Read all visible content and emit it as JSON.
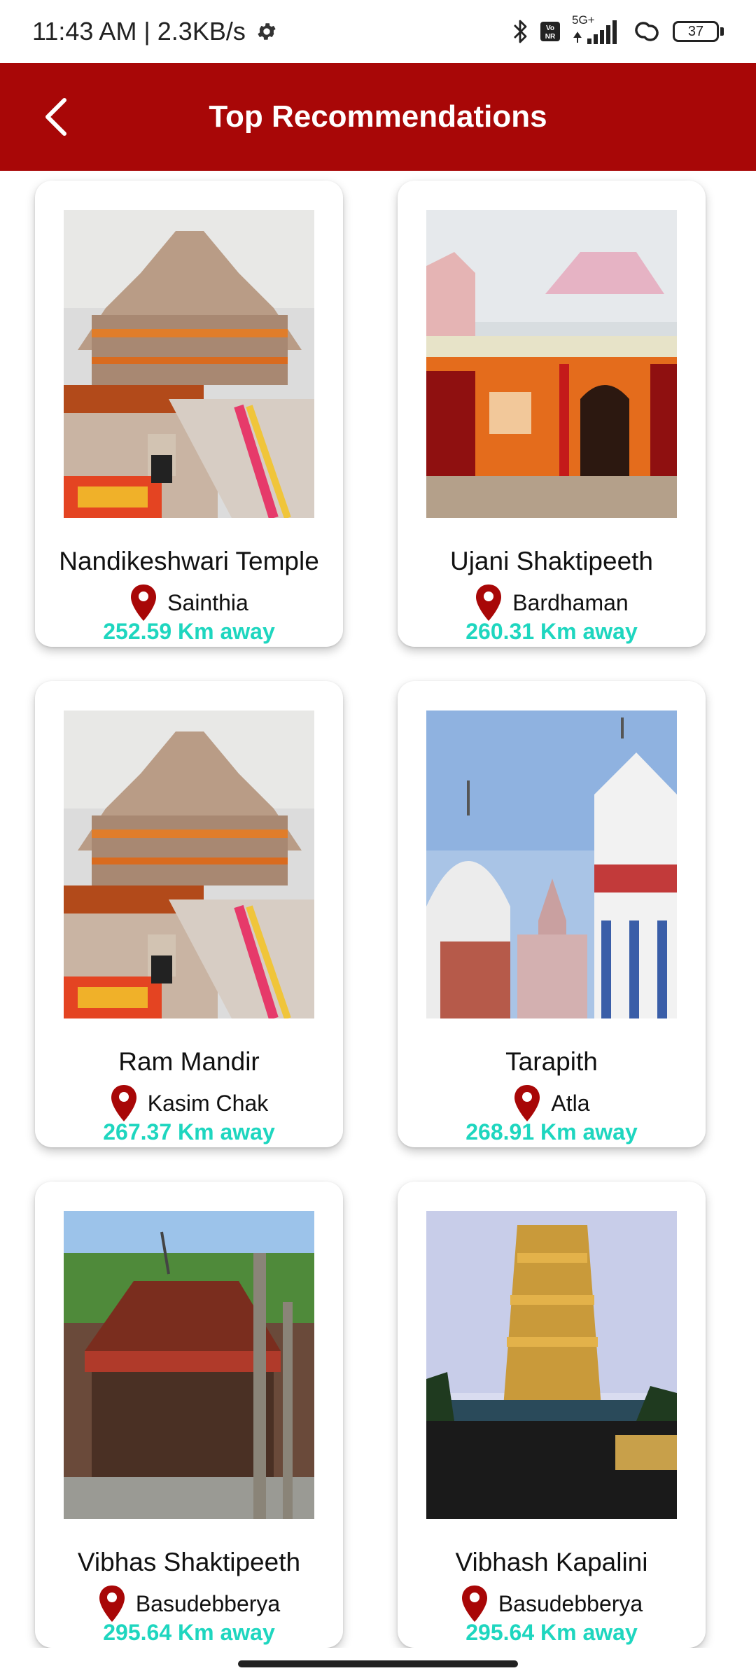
{
  "status_bar": {
    "time_speed": "11:43 AM | 2.3KB/s",
    "network": "5G+",
    "battery": "37"
  },
  "app_bar": {
    "title": "Top Recommendations"
  },
  "colors": {
    "app_bar": "#a80707",
    "distance": "#1ed6bf",
    "pin": "#a80707"
  },
  "places": [
    {
      "name": "Nandikeshwari Temple",
      "city": "Sainthia",
      "distance": "252.59 Km away"
    },
    {
      "name": "Ujani Shaktipeeth",
      "city": "Bardhaman",
      "distance": "260.31 Km away"
    },
    {
      "name": "Ram Mandir",
      "city": "Kasim Chak",
      "distance": "267.37 Km away"
    },
    {
      "name": "Tarapith",
      "city": "Atla",
      "distance": "268.91 Km away"
    },
    {
      "name": "Vibhas Shaktipeeth",
      "city": "Basudebberya",
      "distance": "295.64 Km away"
    },
    {
      "name": "Vibhash Kapalini",
      "city": "Basudebberya",
      "distance": "295.64 Km away"
    }
  ]
}
